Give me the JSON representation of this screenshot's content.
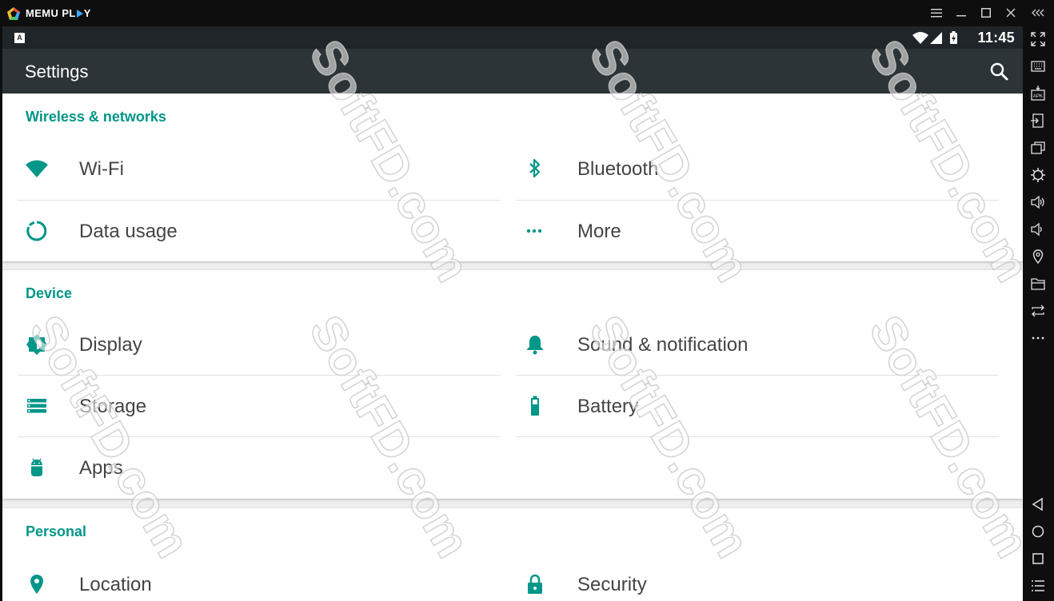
{
  "titlebar": {
    "brand_prefix": "MEMU PL",
    "brand_suffix": "Y",
    "menu_icon": "hamburger-icon",
    "minimize_icon": "minimize-icon",
    "maximize_icon": "maximize-icon",
    "close_icon": "close-icon",
    "collapse_icon": "collapse-sidebar-icon"
  },
  "statusbar": {
    "notification_badge": "A",
    "time": "11:45"
  },
  "appbar": {
    "title": "Settings",
    "search_icon": "search-icon"
  },
  "sections": [
    {
      "title": "Wireless & networks",
      "items": [
        {
          "label": "Wi-Fi",
          "icon": "wifi-icon"
        },
        {
          "label": "Bluetooth",
          "icon": "bluetooth-icon"
        },
        {
          "label": "Data usage",
          "icon": "data-usage-icon"
        },
        {
          "label": "More",
          "icon": "more-dots-icon"
        }
      ]
    },
    {
      "title": "Device",
      "items": [
        {
          "label": "Display",
          "icon": "brightness-icon"
        },
        {
          "label": "Sound & notification",
          "icon": "bell-icon"
        },
        {
          "label": "Storage",
          "icon": "storage-icon"
        },
        {
          "label": "Battery",
          "icon": "battery-icon"
        },
        {
          "label": "Apps",
          "icon": "android-icon"
        }
      ]
    },
    {
      "title": "Personal",
      "items": [
        {
          "label": "Location",
          "icon": "location-pin-icon"
        },
        {
          "label": "Security",
          "icon": "lock-icon"
        }
      ]
    }
  ],
  "sidebar_tools": [
    "fullscreen-icon",
    "keyboard-icon",
    "apk-install-icon",
    "screenshot-icon",
    "multi-window-icon",
    "settings-icon",
    "volume-up-icon",
    "volume-down-icon",
    "location-icon",
    "folder-icon",
    "rotate-icon",
    "more-icon",
    "back-icon",
    "home-icon",
    "recents-icon",
    "menu-list-icon"
  ],
  "colors": {
    "accent": "#009688",
    "appbar": "#2d3437",
    "statusbar": "#1f2528",
    "frame": "#0e0e0e"
  },
  "watermark": "SoftFD.com"
}
